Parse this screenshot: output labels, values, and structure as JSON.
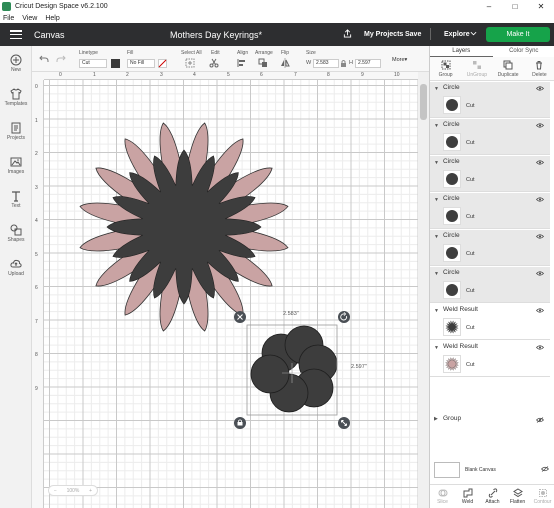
{
  "window": {
    "title": "Cricut Design Space  v6.2.100",
    "controls": [
      "–",
      "□",
      "✕"
    ]
  },
  "menu": [
    "File",
    "View",
    "Help"
  ],
  "header": {
    "canvas_label": "Canvas",
    "project_title": "Mothers Day Keyrings*",
    "my_projects": "My Projects",
    "save": "Save",
    "explore": "Explore",
    "make_it": "Make It"
  },
  "sidebar": {
    "items": [
      {
        "label": "New",
        "icon": "plus-circle-icon"
      },
      {
        "label": "Templates",
        "icon": "shirt-icon"
      },
      {
        "label": "Projects",
        "icon": "projects-icon"
      },
      {
        "label": "Images",
        "icon": "image-icon"
      },
      {
        "label": "Text",
        "icon": "text-icon"
      },
      {
        "label": "Shapes",
        "icon": "shapes-icon"
      },
      {
        "label": "Upload",
        "icon": "cloud-upload-icon"
      }
    ]
  },
  "toolbar": {
    "linetype_label": "Linetype",
    "linetype_value": "Cut",
    "fill_label": "Fill",
    "fill_value": "No Fill",
    "select_all_label": "Select All",
    "edit_label": "Edit",
    "align_label": "Align",
    "arrange_label": "Arrange",
    "flip_label": "Flip",
    "size_label": "Size",
    "w_label": "W",
    "w_value": "2.583",
    "h_label": "H",
    "h_value": "2.597",
    "more_label": "More▾",
    "fill_color": "#3a3a3a"
  },
  "ruler": {
    "top": [
      "0",
      "1",
      "2",
      "3",
      "4",
      "5",
      "6",
      "7",
      "8",
      "9",
      "10"
    ],
    "left": [
      "0",
      "1",
      "2",
      "3",
      "4",
      "5",
      "6",
      "7",
      "8",
      "9"
    ]
  },
  "canvas": {
    "width_readout": "2.583\"",
    "height_readout": "2.597\"",
    "zoom": "100%",
    "flower_color": "#c9a3a3",
    "inner_color": "#3d3d3d"
  },
  "layers_panel": {
    "tabs": [
      "Layers",
      "Color Sync"
    ],
    "actions": [
      {
        "label": "Group",
        "icon": "group-icon",
        "disabled": false
      },
      {
        "label": "UnGroup",
        "icon": "ungroup-icon",
        "disabled": true
      },
      {
        "label": "Duplicate",
        "icon": "duplicate-icon",
        "disabled": false
      },
      {
        "label": "Delete",
        "icon": "trash-icon",
        "disabled": false
      }
    ],
    "layers": [
      {
        "name": "Circle",
        "op": "Cut",
        "thumb": "dark"
      },
      {
        "name": "Circle",
        "op": "Cut",
        "thumb": "dark"
      },
      {
        "name": "Circle",
        "op": "Cut",
        "thumb": "dark"
      },
      {
        "name": "Circle",
        "op": "Cut",
        "thumb": "dark"
      },
      {
        "name": "Circle",
        "op": "Cut",
        "thumb": "dark"
      },
      {
        "name": "Circle",
        "op": "Cut",
        "thumb": "dark"
      },
      {
        "name": "Weld Result",
        "op": "Cut",
        "thumb": "star-dark"
      },
      {
        "name": "Weld Result",
        "op": "Cut",
        "thumb": "star-pink"
      }
    ],
    "group_label": "Group",
    "blank_canvas": "Blank Canvas",
    "bottom": [
      {
        "label": "Slice",
        "icon": "slice-icon",
        "disabled": true
      },
      {
        "label": "Weld",
        "icon": "weld-icon",
        "disabled": false
      },
      {
        "label": "Attach",
        "icon": "attach-icon",
        "disabled": false
      },
      {
        "label": "Flatten",
        "icon": "flatten-icon",
        "disabled": false
      },
      {
        "label": "Contour",
        "icon": "contour-icon",
        "disabled": true
      }
    ]
  }
}
